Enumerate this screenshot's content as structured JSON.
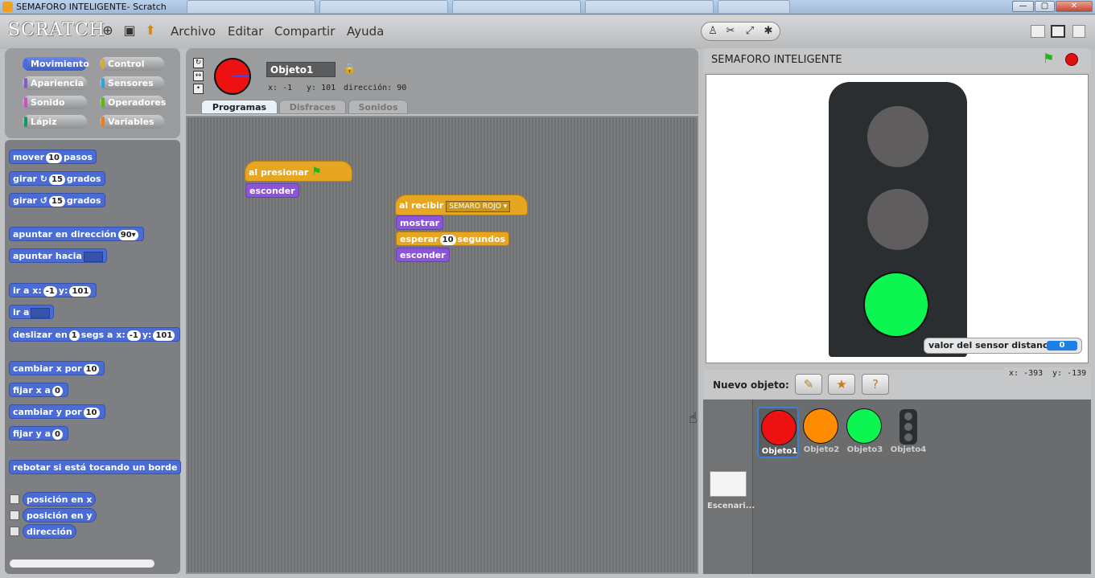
{
  "window": {
    "title": "SEMAFORO INTELIGENTE- Scratch",
    "minimize_label": "—",
    "maximize_label": "▢",
    "close_label": "✕"
  },
  "menu": {
    "logo": "SCRATCH",
    "items": [
      "Archivo",
      "Editar",
      "Compartir",
      "Ayuda"
    ]
  },
  "categories": [
    "Movimiento",
    "Control",
    "Apariencia",
    "Sensores",
    "Sonido",
    "Operadores",
    "Lápiz",
    "Variables"
  ],
  "category_colors": [
    "#4a6cd4",
    "#e6a622",
    "#8a55d7",
    "#2ca5e2",
    "#cf4ad9",
    "#5cb712",
    "#0e9a6c",
    "#ee7d16"
  ],
  "palette": {
    "mover": "mover",
    "mover_val": "10",
    "mover_unit": "pasos",
    "girar_r": "girar",
    "girar_r_val": "15",
    "girar_r_unit": "grados",
    "girar_l": "girar",
    "girar_l_val": "15",
    "girar_l_unit": "grados",
    "apuntar_dir": "apuntar en dirección",
    "apuntar_dir_val": "90▾",
    "apuntar_hacia": "apuntar hacia",
    "ir_a_xy": "ir a x:",
    "ir_a_x_val": "-1",
    "ir_a_y": "y:",
    "ir_a_y_val": "101",
    "ir_a": "ir a",
    "deslizar": "deslizar en",
    "deslizar_val": "1",
    "deslizar_segs": "segs a x:",
    "deslizar_x": "-1",
    "deslizar_y_lbl": "y:",
    "deslizar_y": "101",
    "cambiar_x": "cambiar x por",
    "cambiar_x_val": "10",
    "fijar_x": "fijar x a",
    "fijar_x_val": "0",
    "cambiar_y": "cambiar y por",
    "cambiar_y_val": "10",
    "fijar_y": "fijar y a",
    "fijar_y_val": "0",
    "rebotar": "rebotar si está tocando un borde",
    "posx": "posición en x",
    "posy": "posición en y",
    "direccion": "dirección"
  },
  "sprite": {
    "name": "Objeto1",
    "x_label": "x:",
    "x": "-1",
    "y_label": "y:",
    "y": "101",
    "dir_label": "dirección:",
    "dir": "90",
    "tabs": [
      "Programas",
      "Disfraces",
      "Sonidos"
    ]
  },
  "scripts": {
    "s1_hat": "al presionar",
    "s1_b1": "esconder",
    "s2_hat": "al recibir",
    "s2_msg": "SEMARO ROJO",
    "s2_b1": "mostrar",
    "s2_b2": "esperar",
    "s2_b2_val": "10",
    "s2_b2_unit": "segundos",
    "s2_b3": "esconder"
  },
  "stage": {
    "title": "SEMAFORO INTELIGENTE",
    "sensor_label": "valor del sensor distancia",
    "sensor_value": "0",
    "mouse_x": "x: -393",
    "mouse_y": "y: -139"
  },
  "library": {
    "new_object_label": "Nuevo objeto:",
    "stage_label": "Escenari...",
    "sprites": [
      "Objeto1",
      "Objeto2",
      "Objeto3",
      "Objeto4"
    ]
  }
}
